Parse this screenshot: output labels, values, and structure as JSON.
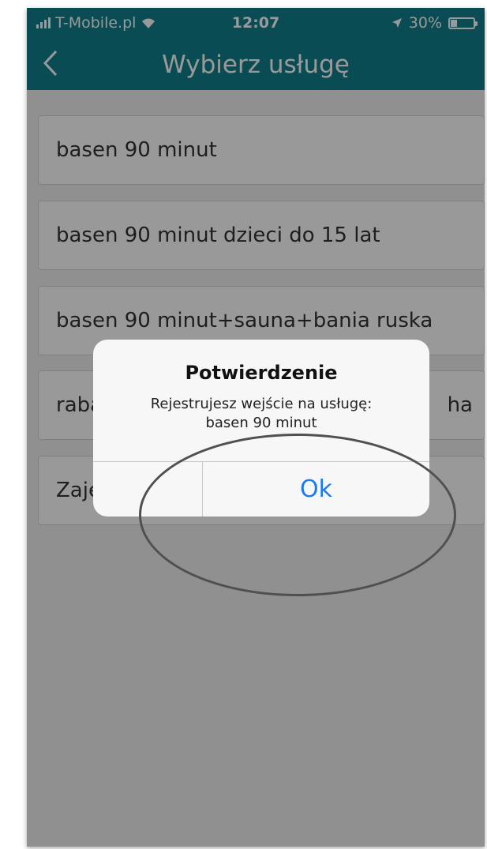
{
  "status_bar": {
    "carrier": "T-Mobile.pl",
    "time": "12:07",
    "battery_percent": "30%",
    "battery_level": 0.3,
    "icons": [
      "signal-icon",
      "wifi-icon",
      "location-icon",
      "battery-icon"
    ]
  },
  "nav": {
    "title": "Wybierz usługę",
    "back_icon": "chevron-left-icon"
  },
  "services": [
    {
      "label": "basen 90 minut"
    },
    {
      "label": "basen 90 minut dzieci do 15 lat"
    },
    {
      "label": "basen 90 minut+sauna+bania ruska"
    },
    {
      "label": "raba",
      "trailing": "ha"
    },
    {
      "label": "Zaję"
    }
  ],
  "dialog": {
    "title": "Potwierdzenie",
    "message_line1": "Rejestrujesz wejście na usługę:",
    "message_line2": "basen 90 minut",
    "ok_label": "Ok"
  },
  "colors": {
    "brand": "#0f7f8b",
    "button_blue": "#1a7cf5"
  }
}
